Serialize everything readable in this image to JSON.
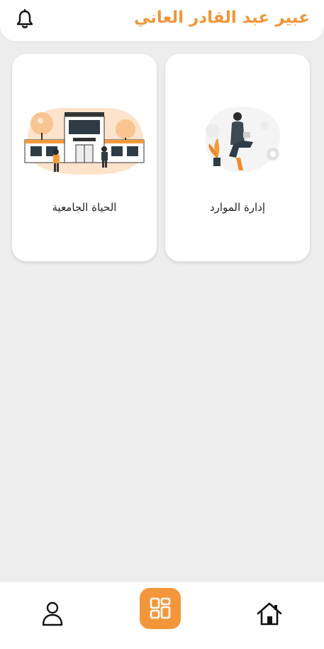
{
  "header": {
    "title": "عبير عبد القادر العاني",
    "notification_icon": "bell-icon",
    "accent_color": "#f0963a"
  },
  "cards": [
    {
      "label": "إدارة الموارد",
      "illustration": "woman-with-plant-and-gears-illustration"
    },
    {
      "label": "الحياة الجامعية",
      "illustration": "school-building-illustration"
    }
  ],
  "bottom_nav": {
    "items": [
      {
        "icon": "home-icon"
      },
      {
        "icon": "grid-icon",
        "active": true
      },
      {
        "icon": "user-icon"
      }
    ],
    "active_color": "#f3963a"
  }
}
